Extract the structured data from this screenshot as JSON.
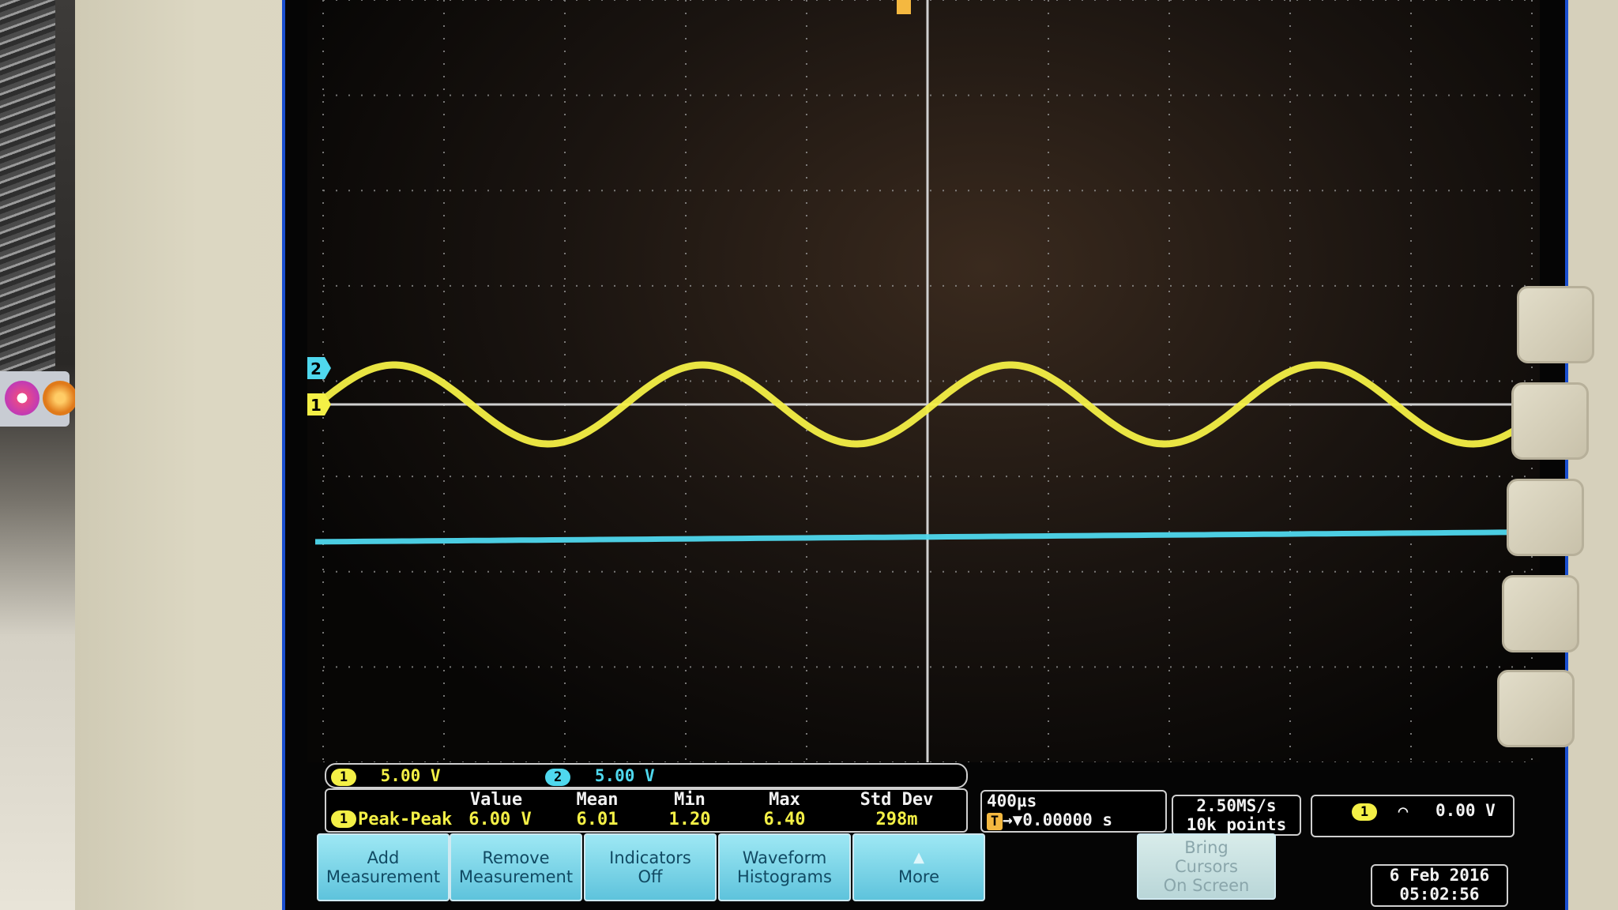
{
  "scope": {
    "channels": {
      "ch1": {
        "number": "1",
        "scale": "5.00 V",
        "color": "#f4f046"
      },
      "ch2": {
        "number": "2",
        "scale": "5.00 V",
        "color": "#4fd8ee"
      }
    },
    "measurement": {
      "channel": "1",
      "name": "Peak-Peak",
      "headers": [
        "Value",
        "Mean",
        "Min",
        "Max",
        "Std Dev"
      ],
      "values": [
        "6.00 V",
        "6.01",
        "1.20",
        "6.40",
        "298m"
      ]
    },
    "timebase": {
      "per_div": "400µs",
      "trigger_position": "→▼0.00000 s"
    },
    "acquisition": {
      "sample_rate": "2.50MS/s",
      "record_length": "10k points"
    },
    "trigger": {
      "channel": "1",
      "slope_symbol": "⌒",
      "level": "0.00 V"
    },
    "menu_buttons": [
      {
        "line1": "Add",
        "line2": "Measurement"
      },
      {
        "line1": "Remove",
        "line2": "Measurement"
      },
      {
        "line1": "Indicators",
        "line2": "Off"
      },
      {
        "line1": "Waveform",
        "line2": "Histograms"
      },
      {
        "line1": "▲",
        "line2": "More"
      },
      {
        "line1": "Bring",
        "line2": "Cursors",
        "line3": "On Screen"
      }
    ],
    "datetime": {
      "date": "6 Feb 2016",
      "time": "05:02:56"
    },
    "trigger_marker": "T"
  }
}
